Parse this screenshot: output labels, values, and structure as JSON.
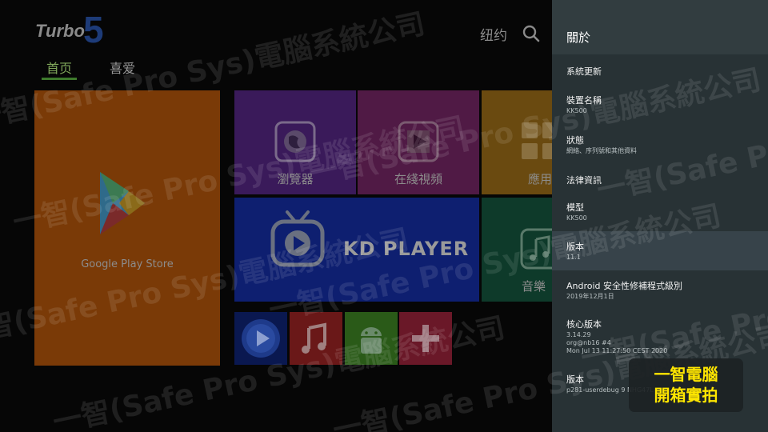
{
  "launcher": {
    "logo_text": "Turbo",
    "logo_number": "5",
    "city": "纽约",
    "tabs": [
      {
        "label": "首页",
        "active": true
      },
      {
        "label": "喜爱",
        "active": false
      }
    ],
    "tiles": {
      "google_play": "Google Play Store",
      "browser": "瀏覽器",
      "online_video": "在綫視頻",
      "apps": "應用",
      "kd_player": "KD PLAYER",
      "music": "音樂"
    }
  },
  "settings": {
    "title": "關於",
    "items": [
      {
        "title": "系統更新",
        "sub": []
      },
      {
        "title": "裝置名稱",
        "sub": [
          "KK500"
        ]
      },
      {
        "title": "狀態",
        "sub": [
          "網絡、序列號和其他資料"
        ]
      },
      {
        "title": "法律資訊",
        "sub": []
      },
      {
        "title": "模型",
        "sub": [
          "KK500"
        ]
      },
      {
        "title": "版本",
        "sub": [
          "11.1"
        ],
        "highlight": true
      },
      {
        "title": "Android 安全性修補程式級別",
        "sub": [
          "2019年12月1日"
        ]
      },
      {
        "title": "核心版本",
        "sub": [
          "3.14.29",
          "org@nb16 #4",
          "Mon Jul 13 11:27:50 CEST 2020"
        ]
      },
      {
        "title": "版本",
        "sub": [
          "p281-userdebug 9 NHG47L"
        ]
      }
    ]
  },
  "watermark": {
    "text": "一智(Safe Pro Sys)電腦系統公司",
    "stamp_line1": "一智電腦",
    "stamp_line2": "開箱實拍"
  },
  "colors": {
    "panel_bg": "#283235",
    "panel_header": "#323d40",
    "highlight_row": "#37434a",
    "stamp_text": "#ffe600"
  },
  "icons": {
    "search": "search-icon",
    "play_store": "google-play-icon",
    "browser": "globe-icon",
    "video": "play-icon",
    "apps": "grid-icon",
    "kd": "tv-icon",
    "music": "music-note-icon"
  }
}
